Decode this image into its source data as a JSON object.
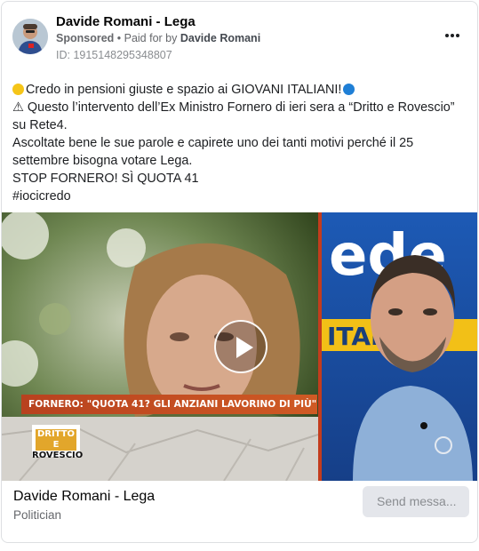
{
  "header": {
    "page_name": "Davide Romani - Lega",
    "sponsored_label": "Sponsored",
    "paid_for_by_prefix": " • Paid for by ",
    "payer": "Davide Romani",
    "ad_id": "ID: 1915148295348807",
    "more_icon": "ellipsis-icon"
  },
  "post": {
    "line1": "Credo in pensioni giuste e spazio ai GIOVANI ITALIANI!",
    "line2": "⚠ Questo l’intervento dell’Ex Ministro Fornero di ieri sera a “Dritto e Rovescio” su Rete4.",
    "line3": "Ascoltate bene le sue parole e capirete uno dei tanti motivi perché il 25 settembre bisogna votare Lega.",
    "line4": "STOP FORNERO! SÌ QUOTA 41",
    "line5": "#iocicredo",
    "emoji_left": "yellow-circle-icon",
    "emoji_right": "blue-circle-icon",
    "emoji_colors": {
      "yellow": "#f5c518",
      "blue": "#1f7fd6"
    }
  },
  "video": {
    "caption": "FORNERO: \"QUOTA 41? GLI ANZIANI LAVORINO DI PIÙ\"",
    "show_logo_line1": "DRITTO E",
    "show_logo_line2": "ROVESCIO",
    "right_panel_text": "ede",
    "right_panel_text2": "ITALIA"
  },
  "footer": {
    "page_name": "Davide Romani - Lega",
    "category": "Politician",
    "send_button": "Send messa..."
  }
}
